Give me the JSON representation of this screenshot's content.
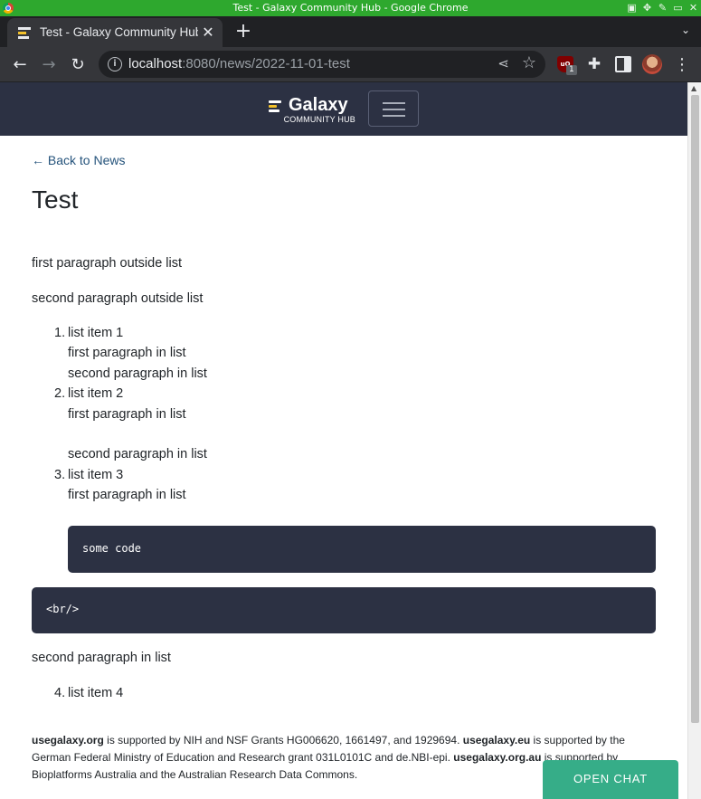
{
  "os_bar": {
    "title": "Test - Galaxy Community Hub - Google Chrome"
  },
  "tab": {
    "title": "Test - Galaxy Community Hub",
    "close": "✕"
  },
  "new_tab": "+",
  "toolbar": {
    "url_host": "localhost",
    "url_rest": ":8080/news/2022-11-01-test",
    "ublock_badge": "1"
  },
  "site": {
    "logo_word": "Galaxy",
    "logo_sub": "COMMUNITY HUB",
    "accent": "#f3c12a",
    "nav_bg": "#2c3143"
  },
  "article": {
    "back_link": "← Back to News",
    "title": "Test",
    "para1": "first paragraph outside list",
    "para2": "second paragraph outside list",
    "list": [
      {
        "num": "1.",
        "label": "list item 1",
        "p1": "first paragraph in list",
        "p2": "second paragraph in list"
      },
      {
        "num": "2.",
        "label": "list item 2",
        "p1": "first paragraph in list",
        "p2": "second paragraph in list"
      },
      {
        "num": "3.",
        "label": "list item 3",
        "p1": "first paragraph in list",
        "code": "some code"
      }
    ],
    "code_br": "<br/>",
    "para3": "second paragraph in list",
    "item4": {
      "num": "4.",
      "label": "list item 4"
    }
  },
  "footer": {
    "org1": "usegalaxy.org",
    "text1": " is supported by NIH and NSF Grants HG006620, 1661497, and 1929694. ",
    "org2": "usegalaxy.eu",
    "text2": " is supported by the German Federal Ministry of Education and Research grant 031L0101C and de.NBI-epi. ",
    "org3": "usegalaxy.org.au",
    "text3": " is supported by Bioplatforms Australia and the Australian Research Data Commons."
  },
  "chat_button": "OPEN CHAT"
}
